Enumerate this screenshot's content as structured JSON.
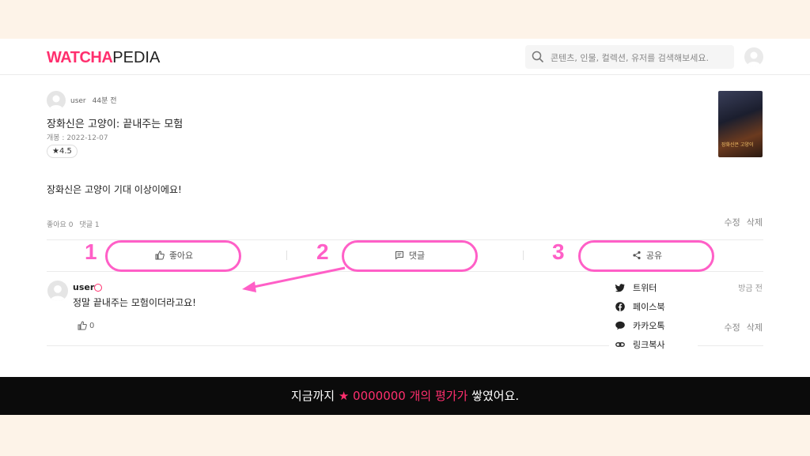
{
  "header": {
    "logo_brand": "WATCHA",
    "logo_suffix": "PEDIA",
    "search_placeholder": "콘텐츠, 인물, 컬렉션, 유저를 검색해보세요."
  },
  "post": {
    "username": "user",
    "time": "44분 전",
    "title": "장화신은 고양이: 끝내주는 모험",
    "release": "개봉 : 2022-12-07",
    "rating": "★4.5",
    "review": "장화신은 고양이 기대 이상이에요!",
    "likes_label": "좋아요 0",
    "comments_label": "댓글 1",
    "edit_label": "수정",
    "delete_label": "삭제",
    "poster_text": "장화신은 고양이"
  },
  "actions": {
    "like": "좋아요",
    "comment": "댓글",
    "share": "공유"
  },
  "annotations": {
    "one": "1",
    "two": "2",
    "three": "3",
    "color": "#ff5fc7"
  },
  "comment": {
    "username": "user",
    "text": "정말 끝내주는 모험이더라고요!",
    "likes": "0",
    "time": "방금 전",
    "edit_label": "수정",
    "delete_label": "삭제"
  },
  "share_menu": [
    {
      "icon": "twitter-icon",
      "label": "트위터"
    },
    {
      "icon": "facebook-icon",
      "label": "페이스북"
    },
    {
      "icon": "kakaotalk-icon",
      "label": "카카오톡"
    },
    {
      "icon": "link-icon",
      "label": "링크복사"
    }
  ],
  "banner": {
    "prefix": "지금까지",
    "highlight": "★ 0000000 개의 평가가",
    "suffix": "쌓였어요."
  },
  "colors": {
    "brand": "#ff2f6e",
    "banner_bg": "#0b0b0b",
    "background": "#fdf3e8"
  }
}
